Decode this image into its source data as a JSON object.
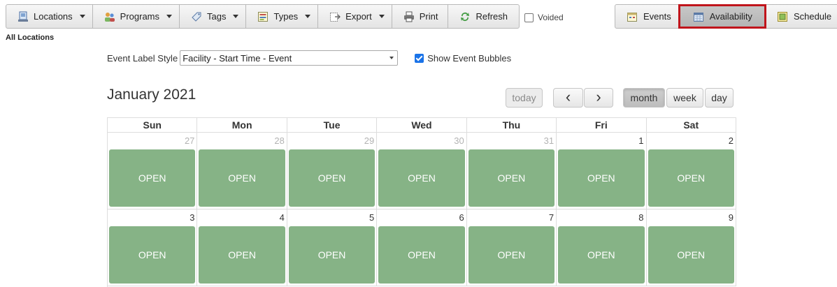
{
  "toolbar": {
    "items": [
      {
        "label": "Locations",
        "icon": "locations-icon",
        "dropdown": true
      },
      {
        "label": "Programs",
        "icon": "programs-icon",
        "dropdown": true
      },
      {
        "label": "Tags",
        "icon": "tag-icon",
        "dropdown": true
      },
      {
        "label": "Types",
        "icon": "types-icon",
        "dropdown": true
      },
      {
        "label": "Export",
        "icon": "export-icon",
        "dropdown": true
      },
      {
        "label": "Print",
        "icon": "printer-icon",
        "dropdown": false
      },
      {
        "label": "Refresh",
        "icon": "refresh-icon",
        "dropdown": false
      }
    ],
    "voided_label": "Voided",
    "voided_checked": false
  },
  "views": {
    "items": [
      {
        "label": "Events",
        "icon": "events-icon"
      },
      {
        "label": "Availability",
        "icon": "availability-icon"
      },
      {
        "label": "Schedule",
        "icon": "schedule-icon"
      }
    ],
    "active": "Availability",
    "highlight_color": "#c0141b"
  },
  "location_filter": "All Locations",
  "label_style": {
    "label": "Event Label Style",
    "selected": "Facility - Start Time - Event",
    "show_bubbles_label": "Show Event Bubbles",
    "show_bubbles_checked": true
  },
  "calendar": {
    "title": "January 2021",
    "today_label": "today",
    "prev_icon": "chevron-left-icon",
    "next_icon": "chevron-right-icon",
    "prev_glyph": "‹",
    "next_glyph": "›",
    "view_buttons": [
      "month",
      "week",
      "day"
    ],
    "active_view": "month",
    "weekdays": [
      "Sun",
      "Mon",
      "Tue",
      "Wed",
      "Thu",
      "Fri",
      "Sat"
    ],
    "event_color": "#86b386",
    "weeks": [
      [
        {
          "day": "27",
          "other_month": true,
          "event": "OPEN"
        },
        {
          "day": "28",
          "other_month": true,
          "event": "OPEN"
        },
        {
          "day": "29",
          "other_month": true,
          "event": "OPEN"
        },
        {
          "day": "30",
          "other_month": true,
          "event": "OPEN"
        },
        {
          "day": "31",
          "other_month": true,
          "event": "OPEN"
        },
        {
          "day": "1",
          "other_month": false,
          "event": "OPEN"
        },
        {
          "day": "2",
          "other_month": false,
          "event": "OPEN"
        }
      ],
      [
        {
          "day": "3",
          "other_month": false,
          "event": "OPEN"
        },
        {
          "day": "4",
          "other_month": false,
          "event": "OPEN"
        },
        {
          "day": "5",
          "other_month": false,
          "event": "OPEN"
        },
        {
          "day": "6",
          "other_month": false,
          "event": "OPEN"
        },
        {
          "day": "7",
          "other_month": false,
          "event": "OPEN"
        },
        {
          "day": "8",
          "other_month": false,
          "event": "OPEN"
        },
        {
          "day": "9",
          "other_month": false,
          "event": "OPEN"
        }
      ]
    ]
  }
}
